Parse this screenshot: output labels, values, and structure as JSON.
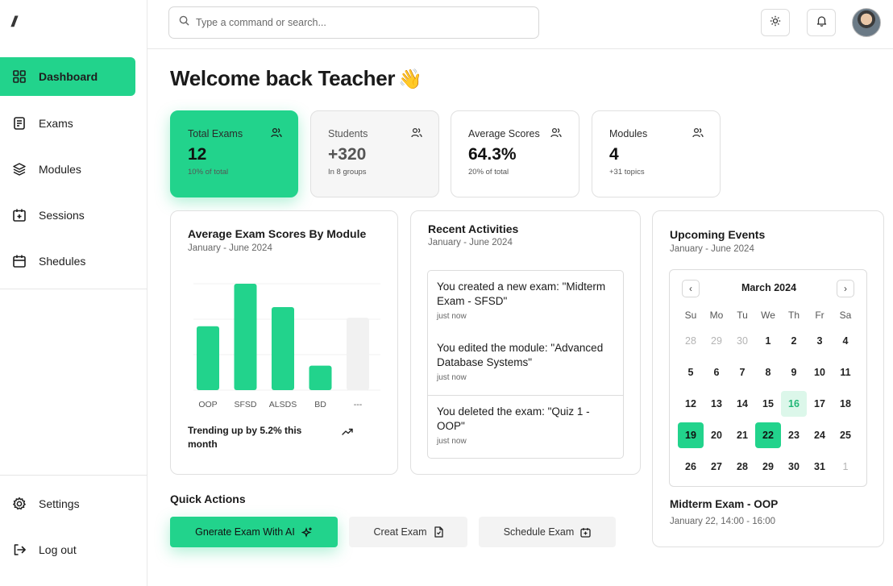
{
  "sidebar": {
    "logo": "//",
    "items": [
      {
        "label": "Dashboard",
        "icon": "dashboard-icon"
      },
      {
        "label": "Exams",
        "icon": "exam-icon"
      },
      {
        "label": "Modules",
        "icon": "layers-icon"
      },
      {
        "label": "Sessions",
        "icon": "calendar-plus-icon"
      },
      {
        "label": "Shedules",
        "icon": "calendar-icon"
      }
    ],
    "bottom": [
      {
        "label": "Settings",
        "icon": "gear-icon"
      },
      {
        "label": "Log out",
        "icon": "logout-icon"
      }
    ]
  },
  "topbar": {
    "search_placeholder": "Type a command or search..."
  },
  "welcome": {
    "title": "Welcome back Teacher",
    "emoji": "👋"
  },
  "stats": [
    {
      "label": "Total Exams",
      "value": "12",
      "sub": "10% of total"
    },
    {
      "label": "Students",
      "value": "+320",
      "sub": "In 8 groups"
    },
    {
      "label": "Average Scores",
      "value": "64.3%",
      "sub": "20% of total"
    },
    {
      "label": "Modules",
      "value": "4",
      "sub": "+31 topics"
    }
  ],
  "scores_card": {
    "title": "Average Exam Scores By Module",
    "subtitle": "January - June 2024",
    "trend": "Trending up by 5.2% this month"
  },
  "chart_data": {
    "type": "bar",
    "categories": [
      "OOP",
      "SFSD",
      "ALSDS",
      "BD",
      "---"
    ],
    "values": [
      60,
      100,
      78,
      23,
      68
    ],
    "colors": [
      "#22d38c",
      "#22d38c",
      "#22d38c",
      "#22d38c",
      "#f1f1f1"
    ]
  },
  "activities_card": {
    "title": "Recent Activities",
    "subtitle": "January - June 2024",
    "items": [
      {
        "text": "You created a new exam: \"Midterm Exam - SFSD\"",
        "time": "just now"
      },
      {
        "text": "You edited the module: \"Advanced Database Systems\"",
        "time": "just now"
      },
      {
        "text": "You deleted the exam: \"Quiz 1 - OOP\"",
        "time": "just now"
      }
    ]
  },
  "events_card": {
    "title": "Upcoming Events",
    "subtitle": "January - June 2024",
    "calendar": {
      "month": "March 2024",
      "prev": "‹",
      "next": "›",
      "weekdays": [
        "Su",
        "Mo",
        "Tu",
        "We",
        "Th",
        "Fr",
        "Sa"
      ],
      "days": [
        {
          "d": "28",
          "m": true
        },
        {
          "d": "29",
          "m": true
        },
        {
          "d": "30",
          "m": true
        },
        {
          "d": "1"
        },
        {
          "d": "2"
        },
        {
          "d": "3"
        },
        {
          "d": "4"
        },
        {
          "d": "5"
        },
        {
          "d": "6"
        },
        {
          "d": "7"
        },
        {
          "d": "8"
        },
        {
          "d": "9"
        },
        {
          "d": "10"
        },
        {
          "d": "11"
        },
        {
          "d": "12"
        },
        {
          "d": "13"
        },
        {
          "d": "14"
        },
        {
          "d": "15"
        },
        {
          "d": "16",
          "today": true
        },
        {
          "d": "17"
        },
        {
          "d": "18"
        },
        {
          "d": "19",
          "sel": true
        },
        {
          "d": "20"
        },
        {
          "d": "21"
        },
        {
          "d": "22",
          "sel": true
        },
        {
          "d": "23"
        },
        {
          "d": "24"
        },
        {
          "d": "25"
        },
        {
          "d": "26"
        },
        {
          "d": "27"
        },
        {
          "d": "28"
        },
        {
          "d": "29"
        },
        {
          "d": "30"
        },
        {
          "d": "31"
        },
        {
          "d": "1",
          "m": true
        }
      ]
    },
    "event_title": "Midterm Exam - OOP",
    "event_time": "January 22, 14:00 - 16:00"
  },
  "quick_actions": {
    "title": "Quick Actions",
    "buttons": [
      {
        "label": "Gnerate Exam With AI",
        "icon": "sparkle-icon"
      },
      {
        "label": "Creat Exam",
        "icon": "file-icon"
      },
      {
        "label": "Schedule Exam",
        "icon": "calendar-plus-icon"
      }
    ]
  },
  "colors": {
    "accent": "#22d38c",
    "accent_light": "#dcf7ea"
  }
}
